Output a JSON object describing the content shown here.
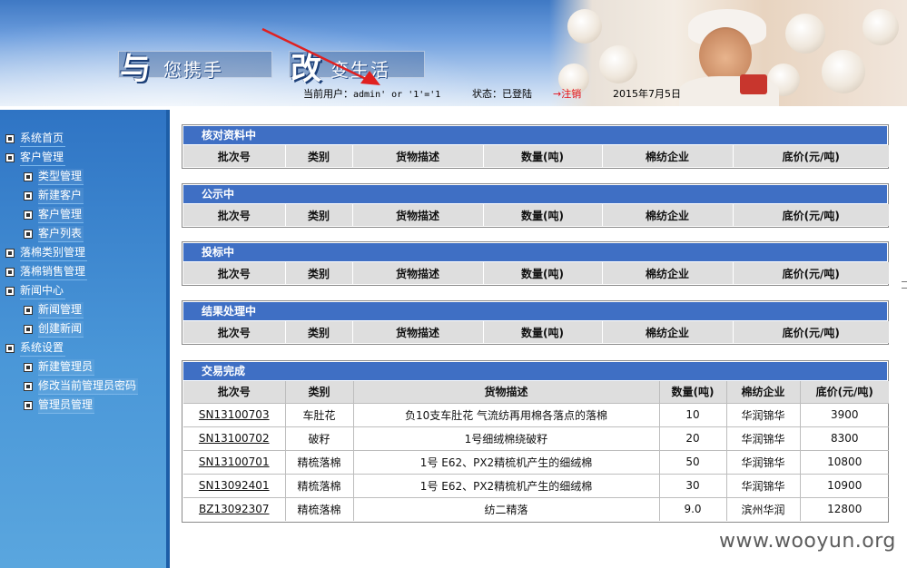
{
  "header": {
    "slogan_char1": "与",
    "slogan_text1": "您携手",
    "slogan_char2": "改",
    "slogan_text2": "变生活",
    "user_label": "当前用户：",
    "user_value": "admin' or '1'='1",
    "status_label": "状态：已登陆",
    "logout_arrow": "→",
    "logout_text": "注销",
    "date": "2015年7月5日"
  },
  "sidebar": {
    "items": [
      {
        "label": "系统首页",
        "level": 0
      },
      {
        "label": "客户管理",
        "level": 0
      },
      {
        "label": "类型管理",
        "level": 1
      },
      {
        "label": "新建客户",
        "level": 1
      },
      {
        "label": "客户管理",
        "level": 1
      },
      {
        "label": "客户列表",
        "level": 1
      },
      {
        "label": "落棉类别管理",
        "level": 0
      },
      {
        "label": "落棉销售管理",
        "level": 0
      },
      {
        "label": "新闻中心",
        "level": 0
      },
      {
        "label": "新闻管理",
        "level": 1
      },
      {
        "label": "创建新闻",
        "level": 1
      },
      {
        "label": "系统设置",
        "level": 0
      },
      {
        "label": "新建管理员",
        "level": 1
      },
      {
        "label": "修改当前管理员密码",
        "level": 1
      },
      {
        "label": "管理员管理",
        "level": 1
      }
    ]
  },
  "columns": [
    "批次号",
    "类别",
    "货物描述",
    "数量(吨)",
    "棉纺企业",
    "底价(元/吨)"
  ],
  "sections": {
    "checking": {
      "title": "核对资料中"
    },
    "publicity": {
      "title": "公示中"
    },
    "bidding": {
      "title": "投标中"
    },
    "result": {
      "title": "结果处理中"
    },
    "completed": {
      "title": "交易完成",
      "rows": [
        {
          "batch": "SN13100703",
          "category": "车肚花",
          "desc": "负10支车肚花  气流纺再用棉各落点的落棉",
          "qty": "10",
          "company": "华润锦华",
          "price": "3900"
        },
        {
          "batch": "SN13100702",
          "category": "破籽",
          "desc": "1号细绒棉绕破籽",
          "qty": "20",
          "company": "华润锦华",
          "price": "8300"
        },
        {
          "batch": "SN13100701",
          "category": "精梳落棉",
          "desc": "1号  E62、PX2精梳机产生的细绒棉",
          "qty": "50",
          "company": "华润锦华",
          "price": "10800"
        },
        {
          "batch": "SN13092401",
          "category": "精梳落棉",
          "desc": "1号  E62、PX2精梳机产生的细绒棉",
          "qty": "30",
          "company": "华润锦华",
          "price": "10900"
        },
        {
          "batch": "BZ13092307",
          "category": "精梳落棉",
          "desc": "纺二精落",
          "qty": "9.0",
          "company": "滨州华润",
          "price": "12800"
        }
      ]
    }
  },
  "watermark": "www.wooyun.org",
  "colors": {
    "section_header": "#3f6fc4",
    "sidebar": "#2f74c4",
    "logout": "#e4101a"
  }
}
